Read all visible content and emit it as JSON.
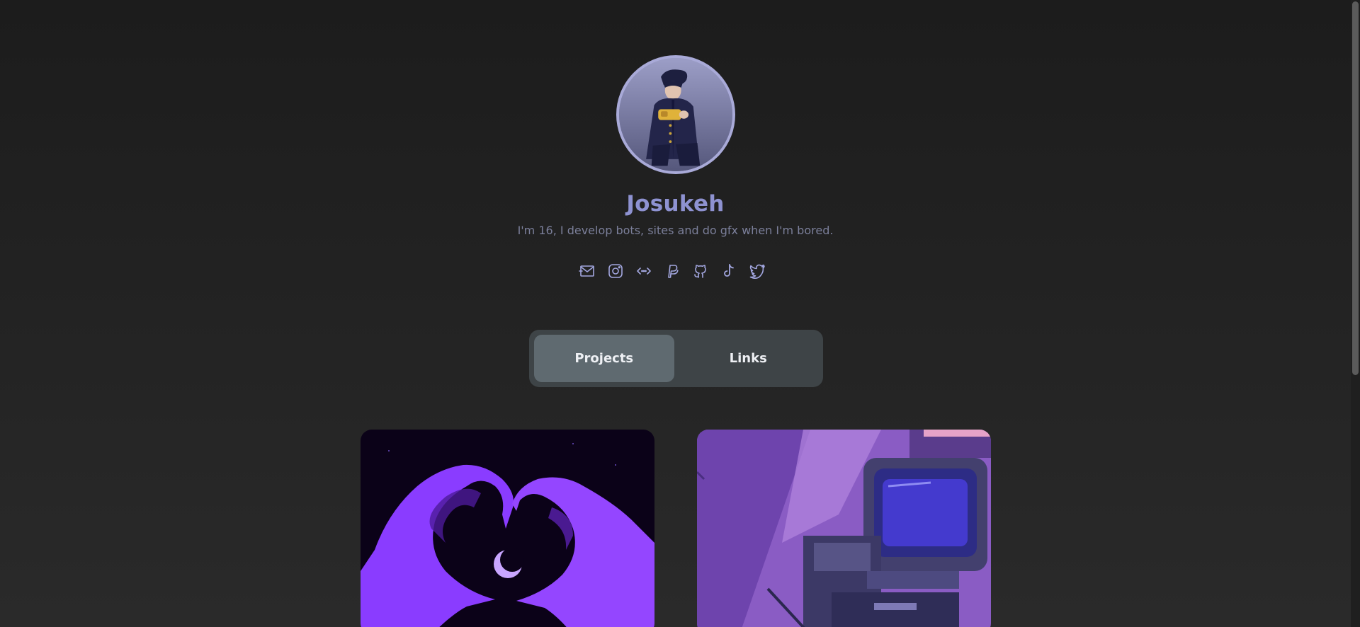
{
  "profile": {
    "name": "Josukeh",
    "bio": "I'm 16, I develop bots, sites and do gfx when I'm bored."
  },
  "socials": [
    {
      "icon": "mail-icon"
    },
    {
      "icon": "instagram-icon"
    },
    {
      "icon": "code-icon"
    },
    {
      "icon": "paypal-icon"
    },
    {
      "icon": "github-icon"
    },
    {
      "icon": "tiktok-icon"
    },
    {
      "icon": "twitter-icon"
    }
  ],
  "tabs": {
    "projects_label": "Projects",
    "links_label": "Links",
    "active": "Projects"
  },
  "projects": [
    {
      "image": "purple-heart-hands-moon-image"
    },
    {
      "image": "pixel-art-retro-computer-image"
    }
  ],
  "colors": {
    "accent": "#8e92d1",
    "background": "#222222",
    "tab_container": "#3e4447",
    "tab_active": "#5f6a70"
  }
}
